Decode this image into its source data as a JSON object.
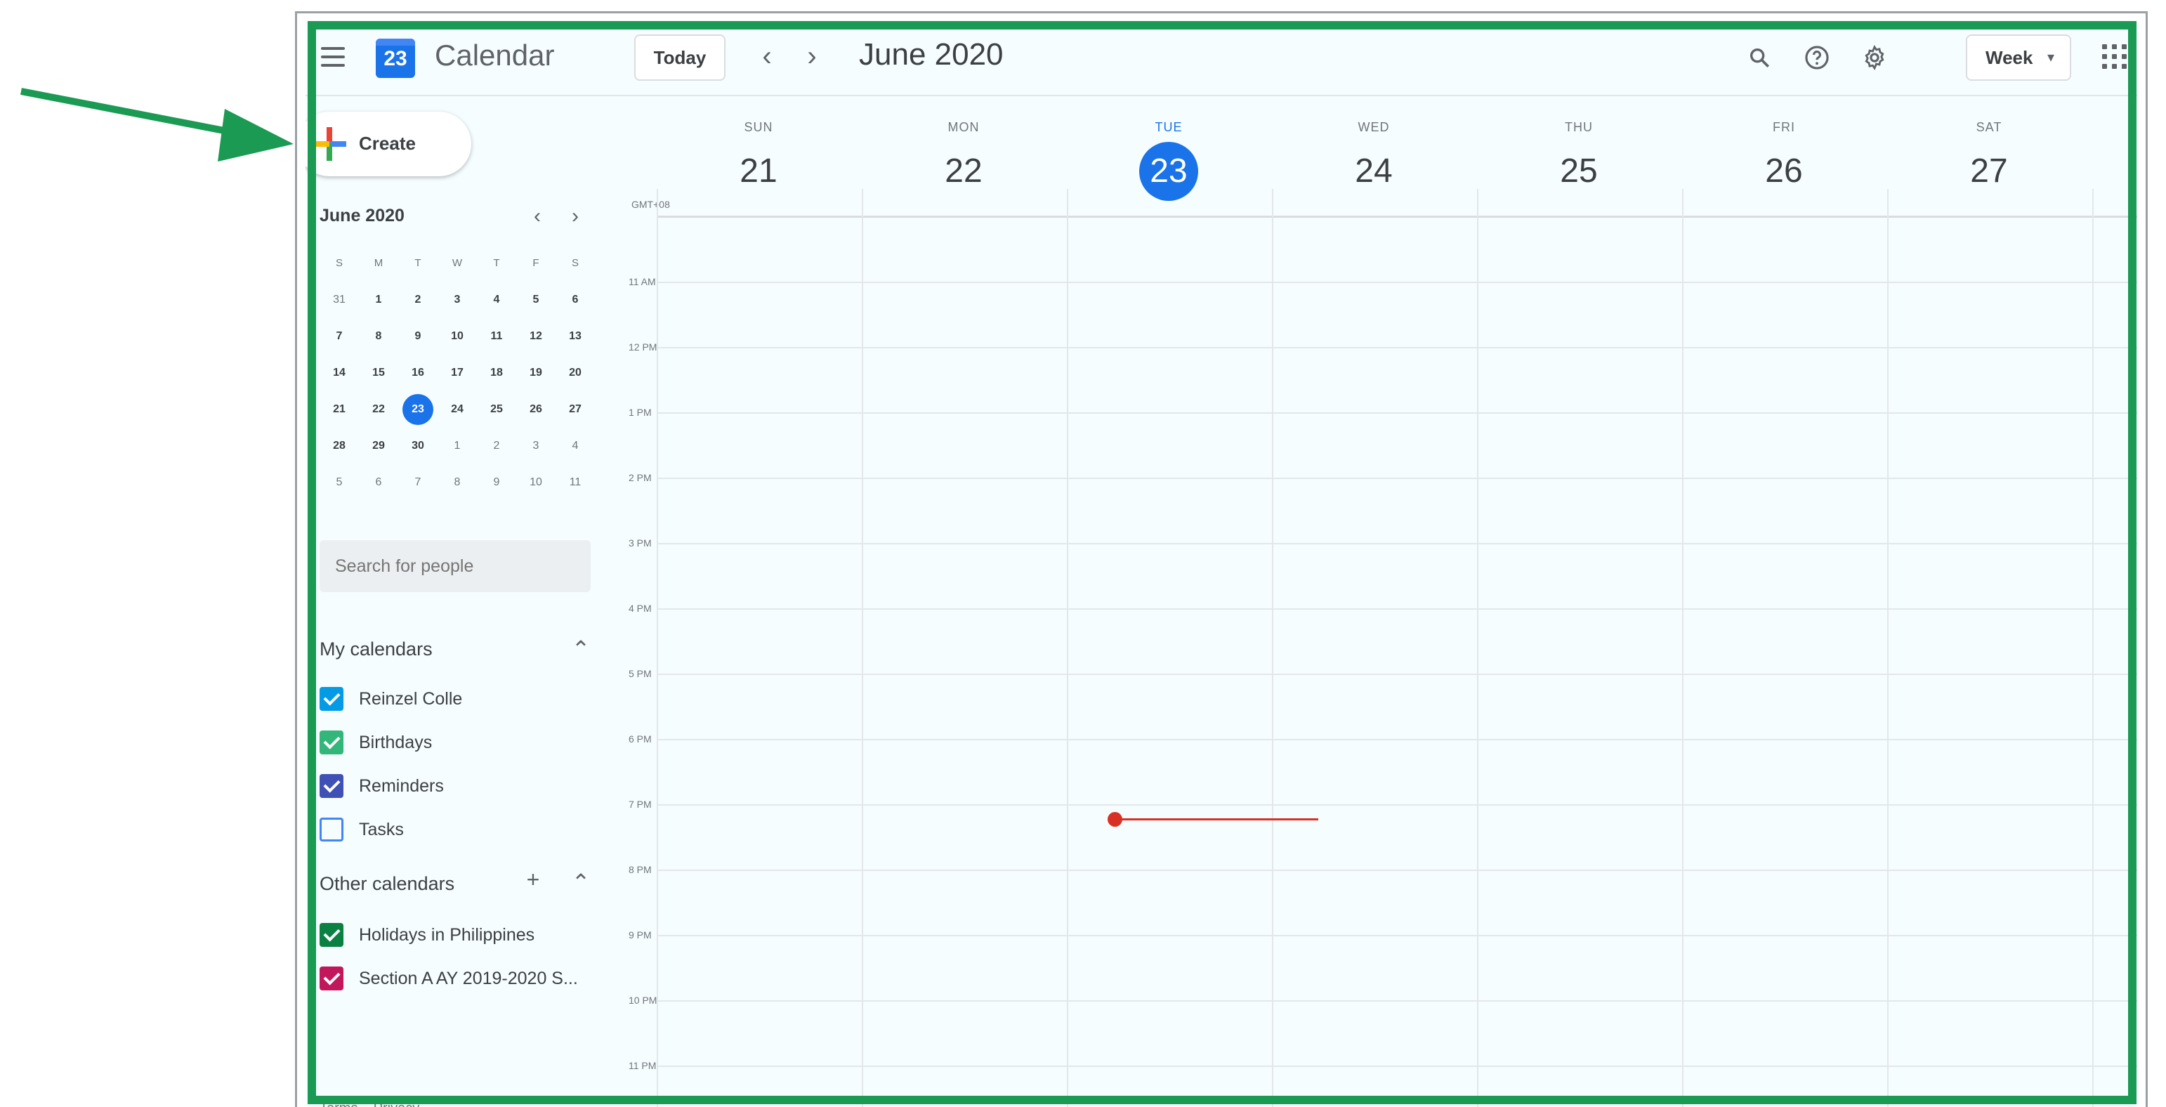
{
  "header": {
    "logo_day": "23",
    "app_name": "Calendar",
    "today_label": "Today",
    "prev_arrow": "‹",
    "next_arrow": "›",
    "period_title": "June 2020",
    "view_label": "Week",
    "icons": [
      "menu-icon",
      "search-icon",
      "help-icon",
      "settings-icon",
      "apps-grid-icon"
    ]
  },
  "sidebar": {
    "create_label": "Create",
    "mini_calendar": {
      "month": "June 2020",
      "weekdays": [
        "S",
        "M",
        "T",
        "W",
        "T",
        "F",
        "S"
      ],
      "weeks": [
        [
          "31",
          "1",
          "2",
          "3",
          "4",
          "5",
          "6"
        ],
        [
          "7",
          "8",
          "9",
          "10",
          "11",
          "12",
          "13"
        ],
        [
          "14",
          "15",
          "16",
          "17",
          "18",
          "19",
          "20"
        ],
        [
          "21",
          "22",
          "23",
          "24",
          "25",
          "26",
          "27"
        ],
        [
          "28",
          "29",
          "30",
          "1",
          "2",
          "3",
          "4"
        ],
        [
          "5",
          "6",
          "7",
          "8",
          "9",
          "10",
          "11"
        ]
      ],
      "selected": "23"
    },
    "search_placeholder": "Search for people",
    "my_calendars": {
      "title": "My calendars",
      "items": [
        {
          "label": "Reinzel Colle",
          "color": "#039be5",
          "checked": true
        },
        {
          "label": "Birthdays",
          "color": "#33b679",
          "checked": true
        },
        {
          "label": "Reminders",
          "color": "#3f51b5",
          "checked": true
        },
        {
          "label": "Tasks",
          "color": "#4285f4",
          "checked": false
        }
      ]
    },
    "other_calendars": {
      "title": "Other calendars",
      "items": [
        {
          "label": "Holidays in Philippines",
          "color": "#0b8043",
          "checked": true
        },
        {
          "label": "Section A AY 2019-2020 S...",
          "color": "#c2185b",
          "checked": true
        }
      ]
    },
    "footer": "Terms – Privacy"
  },
  "week": {
    "timezone": "GMT+08",
    "days": [
      {
        "dow": "SUN",
        "date": "21",
        "today": false
      },
      {
        "dow": "MON",
        "date": "22",
        "today": false
      },
      {
        "dow": "TUE",
        "date": "23",
        "today": true
      },
      {
        "dow": "WED",
        "date": "24",
        "today": false
      },
      {
        "dow": "THU",
        "date": "25",
        "today": false
      },
      {
        "dow": "FRI",
        "date": "26",
        "today": false
      },
      {
        "dow": "SAT",
        "date": "27",
        "today": false
      }
    ],
    "hours": [
      "11 AM",
      "12 PM",
      "1 PM",
      "2 PM",
      "3 PM",
      "4 PM",
      "5 PM",
      "6 PM",
      "7 PM",
      "8 PM",
      "9 PM",
      "10 PM",
      "11 PM"
    ]
  },
  "colors": {
    "accent": "#1a73e8",
    "now_indicator": "#d93025",
    "highlight": "#1a9a52"
  }
}
